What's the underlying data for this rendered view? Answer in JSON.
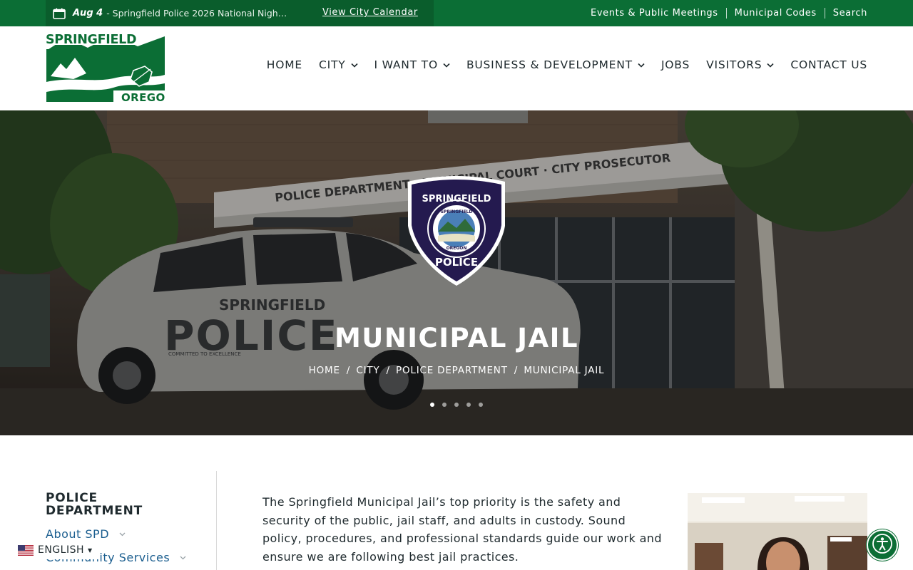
{
  "topbar": {
    "event_date": "Aug 4",
    "event_text": "- Springfield Police 2026 National Night...",
    "calendar_link": "View City Calendar",
    "links": [
      "Events & Public Meetings",
      "Municipal Codes",
      "Search"
    ]
  },
  "header": {
    "logo": {
      "top_text": "SPRINGFIELD",
      "bottom_text": "OREGON"
    },
    "nav": [
      {
        "label": "HOME",
        "dropdown": false
      },
      {
        "label": "CITY",
        "dropdown": true
      },
      {
        "label": "I WANT TO",
        "dropdown": true
      },
      {
        "label": "BUSINESS & DEVELOPMENT",
        "dropdown": true
      },
      {
        "label": "JOBS",
        "dropdown": false
      },
      {
        "label": "VISITORS",
        "dropdown": true
      },
      {
        "label": "CONTACT US",
        "dropdown": false
      }
    ]
  },
  "hero": {
    "building_sign": "POLICE DEPARTMENT · MUNICIPAL COURT · CITY PROSECUTOR",
    "badge": {
      "top_text": "SPRINGFIELD",
      "ring_top": "SPRINGFIELD",
      "ring_bottom": "OREGON",
      "bottom_text": "POLICE"
    },
    "car_text": {
      "springfield": "SPRINGFIELD",
      "police": "POLICE",
      "motto": "COMMITTED TO EXCELLENCE"
    },
    "title": "MUNICIPAL JAIL",
    "breadcrumb": [
      "HOME",
      "CITY",
      "POLICE DEPARTMENT",
      "MUNICIPAL JAIL"
    ],
    "slides": 5,
    "active_slide": 1
  },
  "sidebar": {
    "title": "POLICE DEPARTMENT",
    "items": [
      {
        "label": "About SPD"
      },
      {
        "label": "Community Services"
      }
    ]
  },
  "content": {
    "intro": "The Springfield Municipal Jail’s top priority is the safety and security of the public, jail staff, and adults in custody. Sound policy, procedures, and professional standards guide our work and ensure we are following best jail practices."
  },
  "language": {
    "label": "ENGLISH"
  },
  "colors": {
    "brand_green": "#0b6e35",
    "link_blue": "#1b5e8f",
    "badge_navy": "#241a4f"
  }
}
